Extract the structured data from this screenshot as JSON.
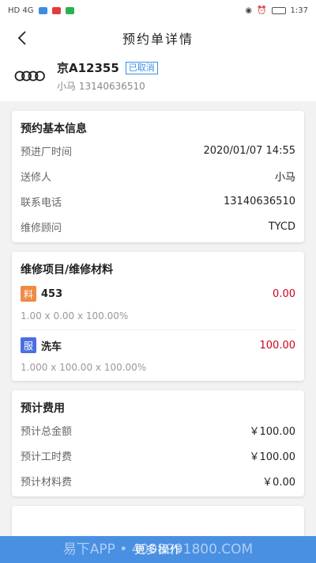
{
  "status": {
    "left_icons": "HD 4G",
    "time": "1:37"
  },
  "nav": {
    "title": "预约单详情"
  },
  "vehicle": {
    "plate": "京A12355",
    "status": "已取消",
    "owner": "小马 13140636510"
  },
  "basic": {
    "title": "预约基本信息",
    "rows": [
      {
        "k": "预进厂时间",
        "v": "2020/01/07 14:55"
      },
      {
        "k": "送修人",
        "v": "小马"
      },
      {
        "k": "联系电话",
        "v": "13140636510"
      },
      {
        "k": "维修顾问",
        "v": "TYCD"
      }
    ]
  },
  "items": {
    "title": "维修项目/维修材料",
    "list": [
      {
        "tag": "料",
        "name": "453",
        "price": "0.00",
        "formula": "1.00 x 0.00 x 100.00%"
      },
      {
        "tag": "服",
        "name": "洗车",
        "price": "100.00",
        "formula": "1.000 x 100.00 x 100.00%"
      }
    ]
  },
  "fees": {
    "title": "预计费用",
    "rows": [
      {
        "k": "预计总金额",
        "v": "￥100.00"
      },
      {
        "k": "预计工时费",
        "v": "￥100.00"
      },
      {
        "k": "预计材料费",
        "v": "￥0.00"
      }
    ]
  },
  "footer": {
    "button": "更多操作",
    "watermark": "易下APP • 4008991800.COM"
  },
  "colors": {
    "accent": "#4a90e2",
    "price_red": "#d0021b",
    "material_tag": "#f08a45",
    "service_tag": "#4a6fe3"
  }
}
